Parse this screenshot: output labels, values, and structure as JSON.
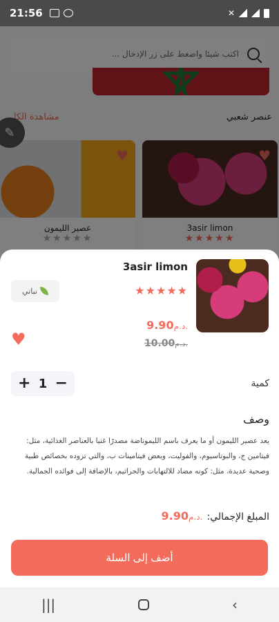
{
  "status_bar": {
    "time": "21:56"
  },
  "background": {
    "search_placeholder": "اكتب شيئا واضغط على زر الإدخال ...",
    "section_title": "عنصر شعبي",
    "see_all": "مشاهدة الكل",
    "cards": [
      {
        "name": "عصير الليمون",
        "stars": "★★★★★"
      },
      {
        "name": "3asir limon",
        "stars": "★★★★★"
      }
    ]
  },
  "product": {
    "title": "3asir limon",
    "stars": "★★★★★",
    "rating": 5,
    "badge": "نباتي",
    "price_value": "9.90",
    "currency": "د.م.",
    "old_price_value": "10.00",
    "quantity_label": "كمية",
    "quantity": "1",
    "plus": "+",
    "minus": "−",
    "description_title": "وصف",
    "description": "يعد عصير الليمون أو ما يعرف باسم الليموناضة مصدرًا غنيا بالعناصر الغذائية، مثل: فيتامين ج، والبوتاسيوم، والفوليت، وبعض فيتامينات ب، والتي تزوده بخصائص طبية وصحية عديدة، مثل: كونه مضاد للالتهابات والجراثيم، بالإضافة إلى فوائده الجمالية.",
    "total_label": "المبلغ الإجمالي:",
    "total_value": "9.90",
    "add_button": "أضف إلى السلة"
  },
  "colors": {
    "accent": "#f26b5b",
    "overlay": "rgba(0,0,0,0.5)"
  },
  "icons": [
    "search-icon",
    "heart-icon",
    "leaf-icon",
    "pencil-icon",
    "recents-icon",
    "home-icon",
    "back-icon"
  ]
}
